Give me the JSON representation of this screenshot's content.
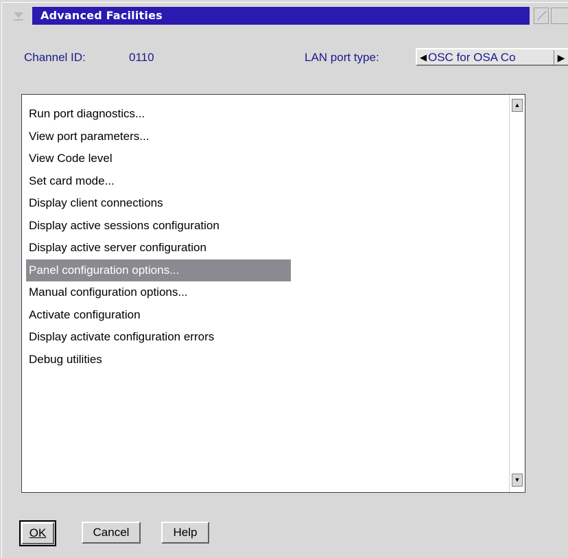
{
  "window": {
    "title": "Advanced Facilities"
  },
  "header": {
    "channel_label": "Channel ID:",
    "channel_value": "0110",
    "lan_label": "LAN port type:",
    "lan_value": "OSC for OSA Co"
  },
  "list": {
    "items": [
      "Run port diagnostics...",
      "View port parameters...",
      "View Code level",
      "Set card mode...",
      "Display client connections",
      "Display active sessions configuration",
      "Display active server configuration",
      "Panel configuration options...",
      "Manual configuration options...",
      "Activate configuration",
      "Display activate configuration errors",
      "Debug utilities"
    ],
    "selected_index": 7
  },
  "buttons": {
    "ok_label": "OK",
    "cancel_label": "Cancel",
    "help_label": "Help"
  },
  "colors": {
    "title_bar": "#2a1ab0",
    "label_text": "#1a1a8c",
    "selection": "#8c8a90",
    "background": "#d8d8d8"
  }
}
